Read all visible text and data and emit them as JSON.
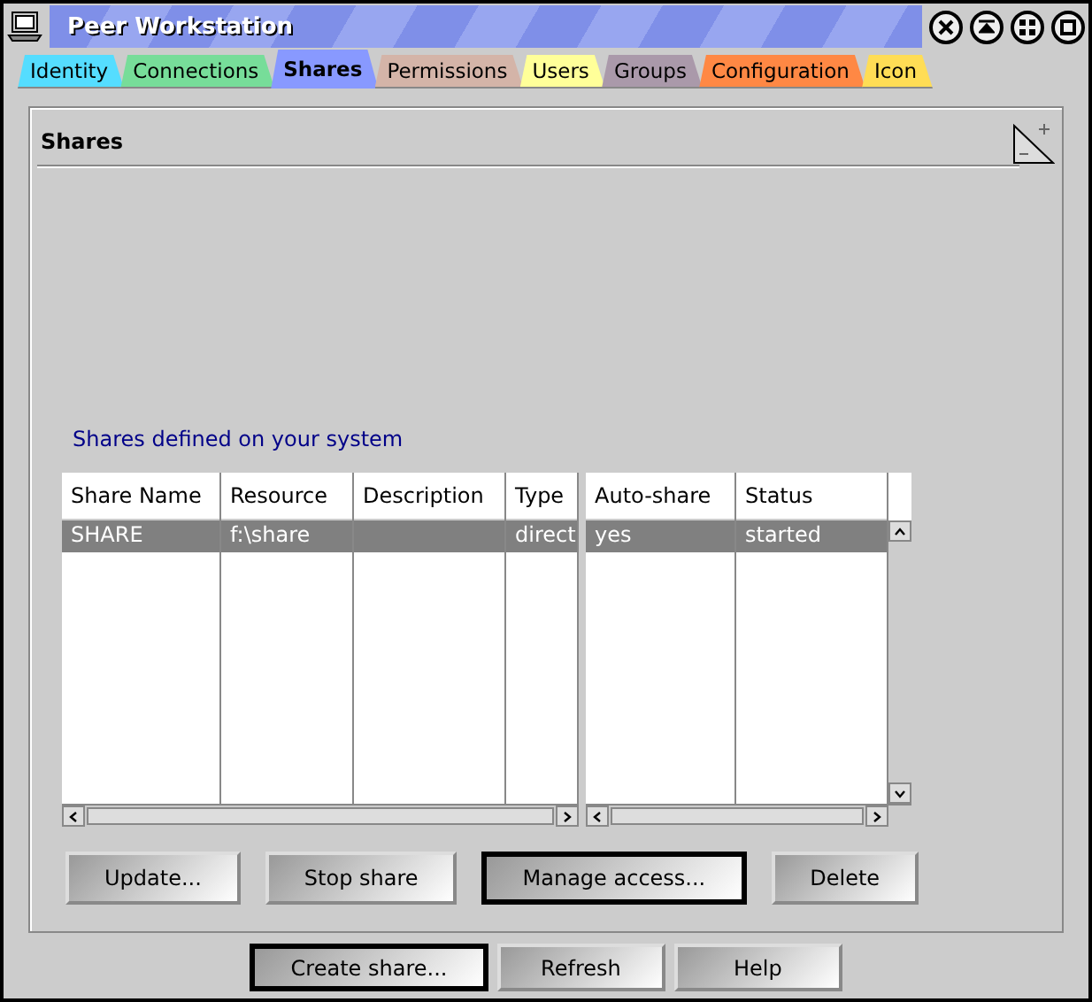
{
  "window": {
    "title": "Peer Workstation"
  },
  "tabs": [
    {
      "label": "Identity",
      "selected": false,
      "color": "#55ddff"
    },
    {
      "label": "Connections",
      "selected": false,
      "color": "#77dd99"
    },
    {
      "label": "Shares",
      "selected": true,
      "color": "#8899ff"
    },
    {
      "label": "Permissions",
      "selected": false,
      "color": "#d4b4a8"
    },
    {
      "label": "Users",
      "selected": false,
      "color": "#ffff99"
    },
    {
      "label": "Groups",
      "selected": false,
      "color": "#aa99aa"
    },
    {
      "label": "Configuration",
      "selected": false,
      "color": "#ff8844"
    },
    {
      "label": "Icon",
      "selected": false,
      "color": "#ffdd55"
    }
  ],
  "page": {
    "title": "Shares",
    "table_caption": "Shares defined on your system"
  },
  "table": {
    "left_columns": [
      "Share Name",
      "Resource",
      "Description",
      "Type"
    ],
    "right_columns": [
      "Auto-share",
      "Status"
    ],
    "rows": [
      {
        "cells": [
          "SHARE",
          "f:\\share",
          "",
          "direct"
        ],
        "right_cells": [
          "yes",
          "started"
        ],
        "selected": true
      }
    ]
  },
  "page_buttons": [
    {
      "label": "Update...",
      "default": false
    },
    {
      "label": "Stop share",
      "default": false
    },
    {
      "label": "Manage access...",
      "default": true
    },
    {
      "label": "Delete",
      "default": false
    }
  ],
  "dialog_buttons": [
    {
      "label": "Create share...",
      "default": true
    },
    {
      "label": "Refresh",
      "default": false
    },
    {
      "label": "Help",
      "default": false
    }
  ]
}
